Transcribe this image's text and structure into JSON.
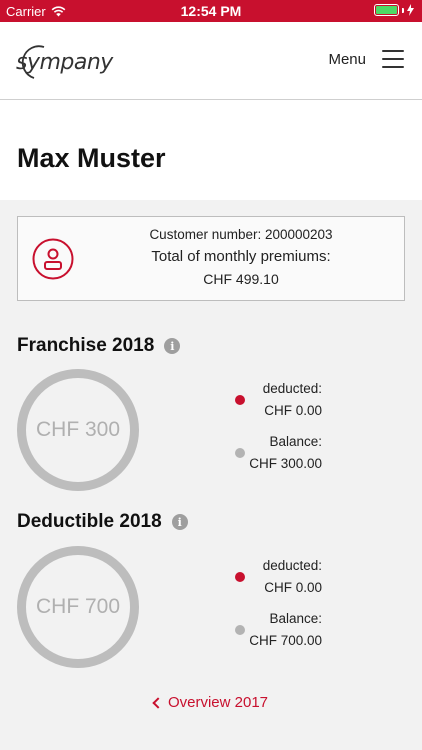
{
  "status_bar": {
    "carrier": "Carrier",
    "time": "12:54 PM"
  },
  "header": {
    "logo_text": "sympany",
    "menu_label": "Menu"
  },
  "profile": {
    "name": "Max Muster"
  },
  "summary_card": {
    "customer_number_line": "Customer number: 200000203",
    "premiums_label": "Total of monthly premiums:",
    "premiums_value": "CHF 499.10"
  },
  "sections": [
    {
      "title": "Franchise 2018",
      "ring_label": "CHF 300",
      "deducted_label": "deducted:",
      "deducted_value": "CHF 0.00",
      "balance_label": "Balance:",
      "balance_value": "CHF 300.00"
    },
    {
      "title": "Deductible 2018",
      "ring_label": "CHF 700",
      "deducted_label": "deducted:",
      "deducted_value": "CHF 0.00",
      "balance_label": "Balance:",
      "balance_value": "CHF 700.00"
    }
  ],
  "footer": {
    "back_link": "Overview 2017"
  },
  "colors": {
    "brand": "#c8102e",
    "ring": "#bdbdbd",
    "background": "#f2f2f2"
  },
  "icons": {
    "wifi": "wifi-icon",
    "battery": "battery-icon",
    "charging": "charging-icon",
    "profile": "user-icon",
    "info": "info-icon",
    "back": "chevron-left-icon",
    "menu": "hamburger-icon"
  }
}
